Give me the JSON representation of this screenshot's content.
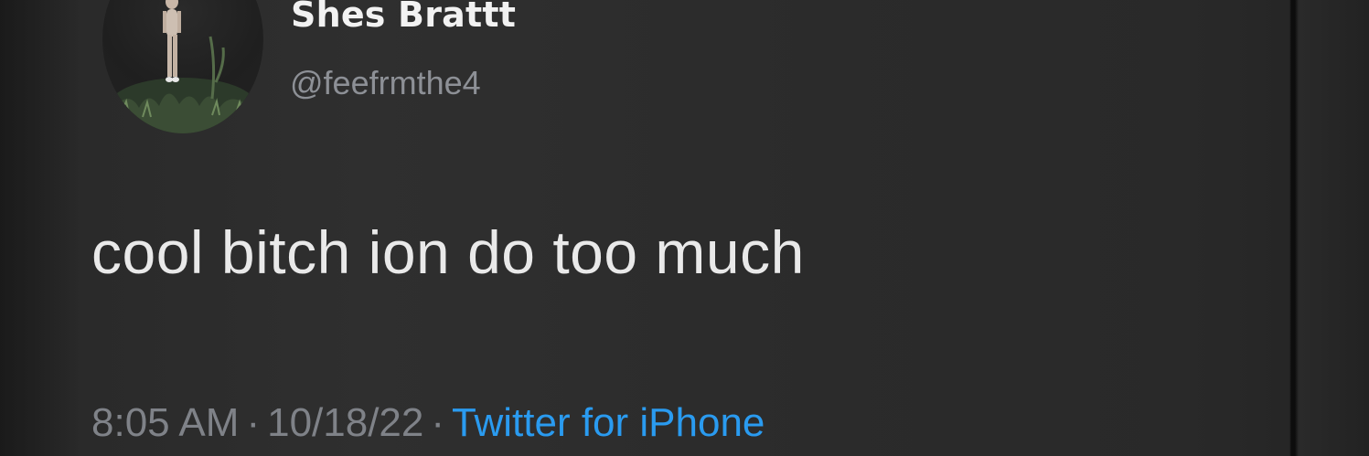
{
  "tweet": {
    "display_name": "Shes Brattt",
    "handle": "@feefrmthe4",
    "text": "cool bitch ion do too much",
    "time": "8:05 AM",
    "separator": "·",
    "date": "10/18/22",
    "source": "Twitter for iPhone"
  },
  "colors": {
    "background": "#2b2b2b",
    "text": "#e9e9e9",
    "muted": "#7f8288",
    "link": "#2a9bf0"
  },
  "icons": {
    "avatar": "profile-photo"
  }
}
